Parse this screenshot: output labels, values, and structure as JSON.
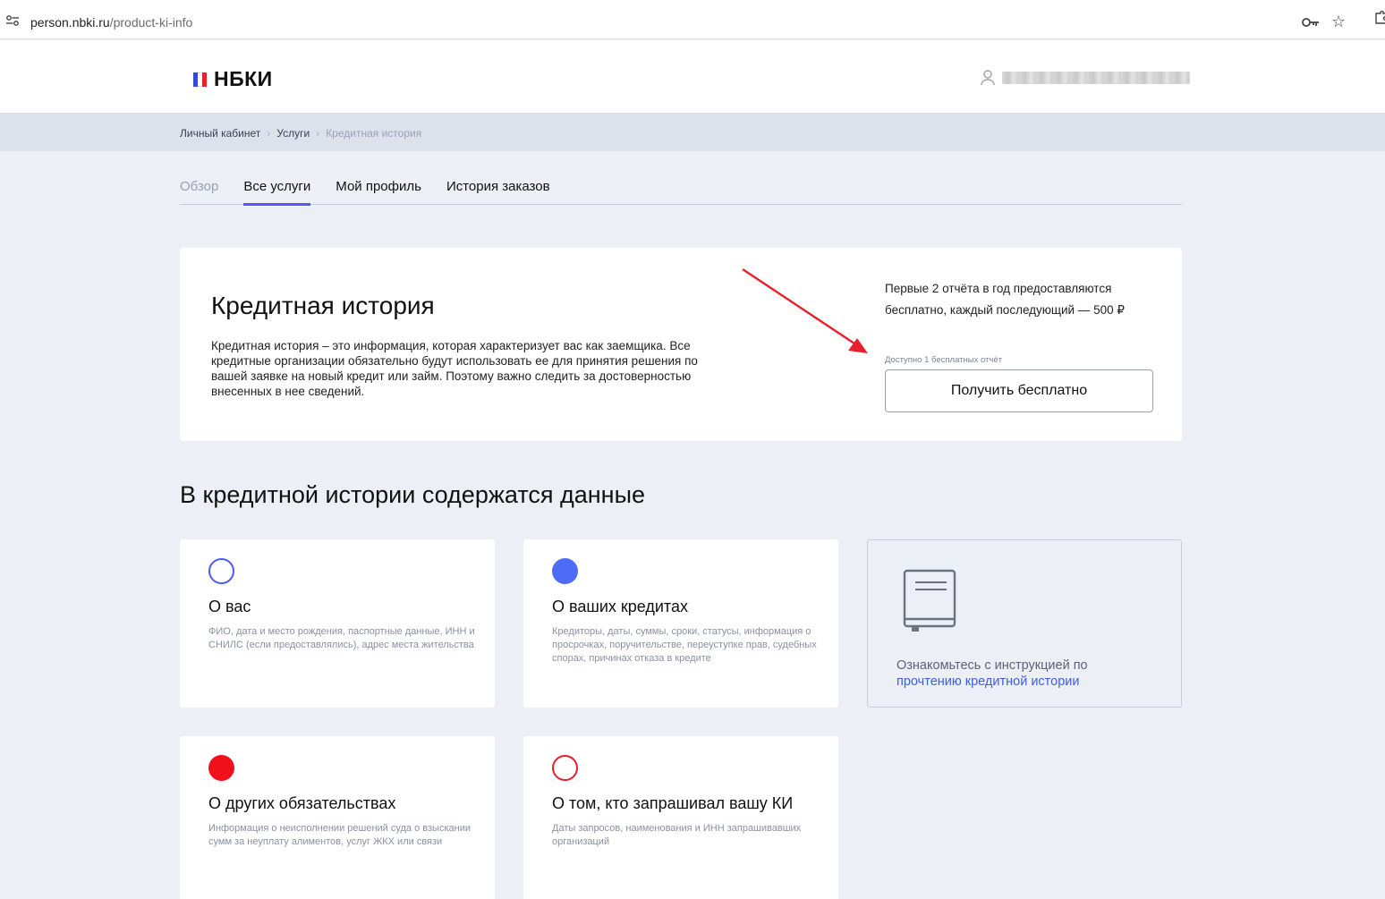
{
  "browser": {
    "url_host": "person.nbki.ru",
    "url_path": "/product-ki-info"
  },
  "header": {
    "logo_text": "НБКИ",
    "logo_colors": [
      "#2f4bd8",
      "#ffffff",
      "#e8202e"
    ]
  },
  "breadcrumbs": {
    "items": [
      "Личный кабинет",
      "Услуги"
    ],
    "current": "Кредитная история",
    "separator": "›"
  },
  "tabs": [
    {
      "label": "Обзор",
      "state": "muted"
    },
    {
      "label": "Все услуги",
      "state": "active"
    },
    {
      "label": "Мой профиль",
      "state": "normal"
    },
    {
      "label": "История заказов",
      "state": "normal"
    }
  ],
  "hero": {
    "title": "Кредитная история",
    "description": "Кредитная история – это информация, которая характеризует вас как заемщика. Все кредитные организации обязательно будут использовать ее для принятия решения по вашей заявке на новый кредит или займ. Поэтому важно следить за достоверностью внесенных в нее сведений.",
    "price_note_line1": "Первые 2 отчёта в год предоставляются",
    "price_note_line2": "бесплатно, каждый последующий — 500 ₽",
    "free_left": "Доступно 1 бесплатных отчёт",
    "cta_label": "Получить бесплатно"
  },
  "section": {
    "title": "В кредитной истории содержатся данные"
  },
  "cards": [
    {
      "title": "О вас",
      "description": "ФИО, дата и место рождения, паспортные данные, ИНН и СНИЛС (если предоставлялись), адрес места жительства",
      "dot": "outline",
      "color": "#4c5cf0"
    },
    {
      "title": "О ваших кредитах",
      "description": "Кредиторы, даты, суммы, сроки, статусы, информация о просрочках, поручительстве, переуступке прав, судебных спорах, причинах отказа в кредите",
      "dot": "filled",
      "color": "#4c6cf5"
    },
    {
      "title": "О других обязательствах",
      "description": "Информация о неисполнении решений суда о взыскании сумм за неуплату алиментов, услуг ЖКХ или связи",
      "dot": "filled",
      "color": "#f0101c"
    },
    {
      "title": "О том, кто запрашивал вашу КИ",
      "description": "Даты запросов, наименования и ИНН запрашивавших организаций",
      "dot": "outline",
      "color": "#e8202e"
    }
  ],
  "guide": {
    "text": "Ознакомьтесь с инструкцией по",
    "link": "прочтению кредитной истории",
    "icon": "book-icon"
  },
  "colors": {
    "accent": "#4c5cf0",
    "annotation_arrow": "#e8202e"
  }
}
